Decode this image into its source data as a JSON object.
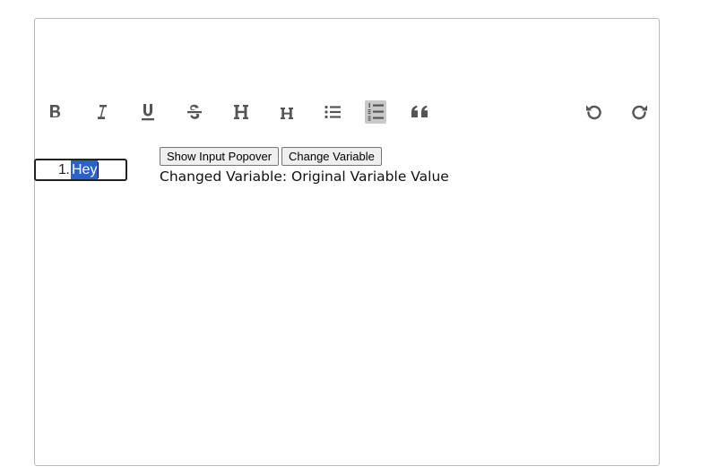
{
  "toolbar": {
    "items": [
      {
        "name": "bold",
        "icon": "bold-icon",
        "active": false
      },
      {
        "name": "italic",
        "icon": "italic-icon",
        "active": false
      },
      {
        "name": "underline",
        "icon": "underline-icon",
        "active": false
      },
      {
        "name": "strikethrough",
        "icon": "strikethrough-icon",
        "active": false
      },
      {
        "name": "heading-1",
        "icon": "heading-large-icon",
        "active": false
      },
      {
        "name": "heading-2",
        "icon": "heading-small-icon",
        "active": false
      },
      {
        "name": "bullet-list",
        "icon": "bullet-list-icon",
        "active": false
      },
      {
        "name": "ordered-list",
        "icon": "ordered-list-icon",
        "active": true
      },
      {
        "name": "blockquote",
        "icon": "quote-icon",
        "active": false
      },
      {
        "name": "undo",
        "icon": "undo-icon",
        "active": false
      },
      {
        "name": "redo",
        "icon": "redo-icon",
        "active": false
      }
    ],
    "icon_color": "#555555",
    "active_bg": "#c9c9c9"
  },
  "editor": {
    "list_number": "1.",
    "selected_text": "Hey",
    "selection_color": "#2a62cc"
  },
  "buttons": {
    "show_input_popover": "Show Input Popover",
    "change_variable": "Change Variable"
  },
  "status": {
    "changed_variable_text": "Changed Variable: Original Variable Value"
  }
}
